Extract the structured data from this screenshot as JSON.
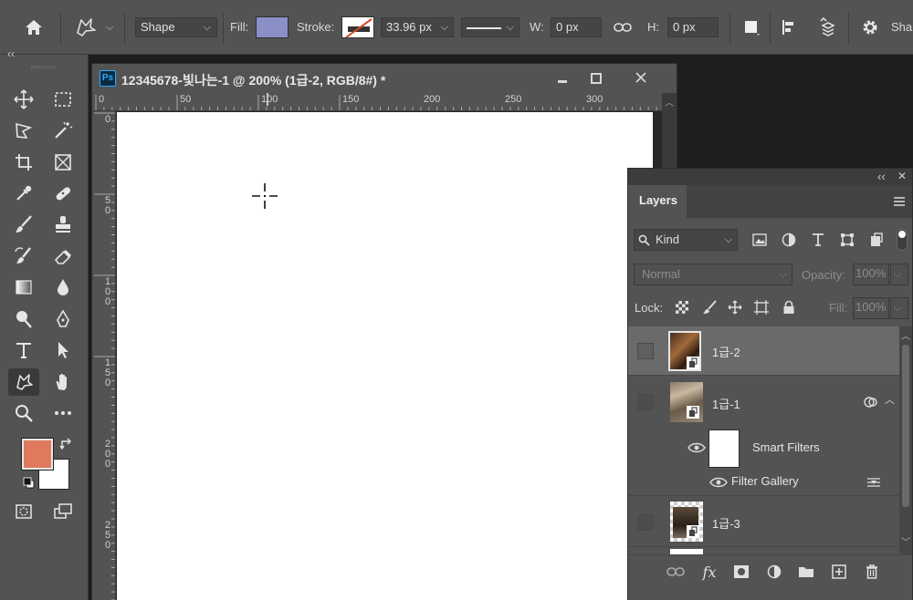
{
  "options_bar": {
    "tool_mode": "Shape",
    "fill_label": "Fill:",
    "fill_color": "#8a8fc6",
    "stroke_label": "Stroke:",
    "stroke_width": "33.96 px",
    "w_label": "W:",
    "w_value": "0 px",
    "h_label": "H:",
    "h_value": "0 px",
    "overflow_label": "Sha"
  },
  "toolbar": {
    "collapse_label": "‹‹",
    "foreground_color": "#e07a5f",
    "background_color": "#ffffff"
  },
  "document": {
    "app_badge": "Ps",
    "title": "12345678-빛나는-1 @ 200% (1급-2, RGB/8#) *",
    "ruler_h": [
      "0",
      "50",
      "100",
      "150",
      "200",
      "250",
      "300"
    ],
    "ruler_v": [
      "0",
      "5 0",
      "1 0 0",
      "1 5 0",
      "2 0 0",
      "2 5 0"
    ],
    "canvas_color": "#ffffff"
  },
  "layers_panel": {
    "collapse_label": "‹‹",
    "close_label": "✕",
    "tab": "Layers",
    "filter_kind": "Kind",
    "blend_mode": "Normal",
    "opacity_label": "Opacity:",
    "opacity_value": "100%",
    "lock_label": "Lock:",
    "fill_label": "Fill:",
    "fill_value": "100%",
    "layers": [
      {
        "name": "1급-2",
        "selected": true
      },
      {
        "name": "1급-1",
        "selected": false
      },
      {
        "name": "Smart Filters"
      },
      {
        "name": "Filter Gallery"
      },
      {
        "name": "1급-3",
        "selected": false
      }
    ]
  }
}
